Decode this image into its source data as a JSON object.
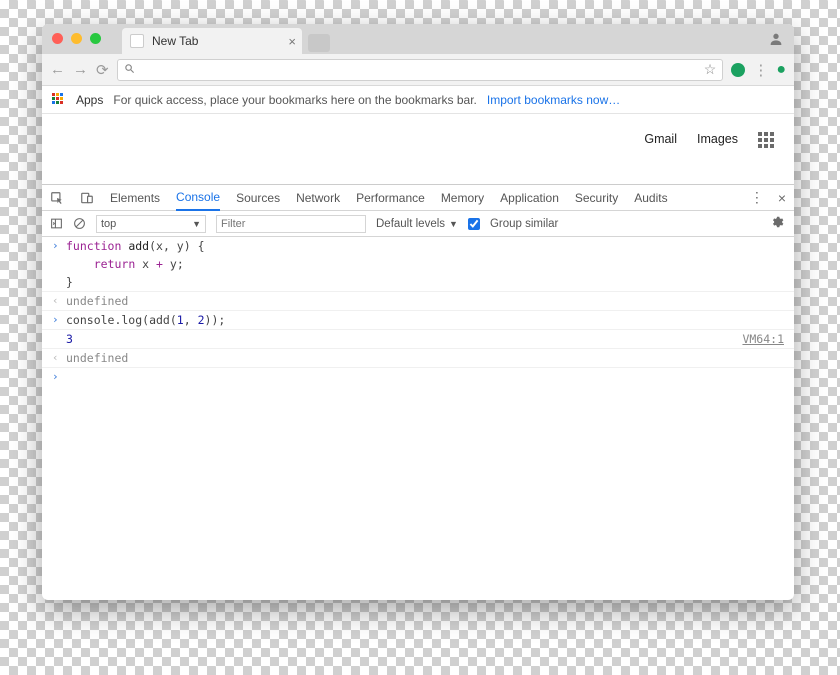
{
  "titlebar": {
    "tab_title": "New Tab"
  },
  "bookmarks": {
    "apps_label": "Apps",
    "hint": "For quick access, place your bookmarks here on the bookmarks bar.",
    "import_link": "Import bookmarks now…"
  },
  "ntp": {
    "gmail": "Gmail",
    "images": "Images"
  },
  "devtools": {
    "tabs": {
      "elements": "Elements",
      "console": "Console",
      "sources": "Sources",
      "network": "Network",
      "performance": "Performance",
      "memory": "Memory",
      "application": "Application",
      "security": "Security",
      "audits": "Audits"
    },
    "context": "top",
    "filter_placeholder": "Filter",
    "levels_label": "Default levels",
    "group_label": "Group similar"
  },
  "console": {
    "line1": "function add(x, y) {",
    "line2": "    return x + y;",
    "line3": "}",
    "out1": "undefined",
    "line4": "console.log(add(1, 2));",
    "result": "3",
    "vmref": "VM64:1",
    "out2": "undefined"
  }
}
